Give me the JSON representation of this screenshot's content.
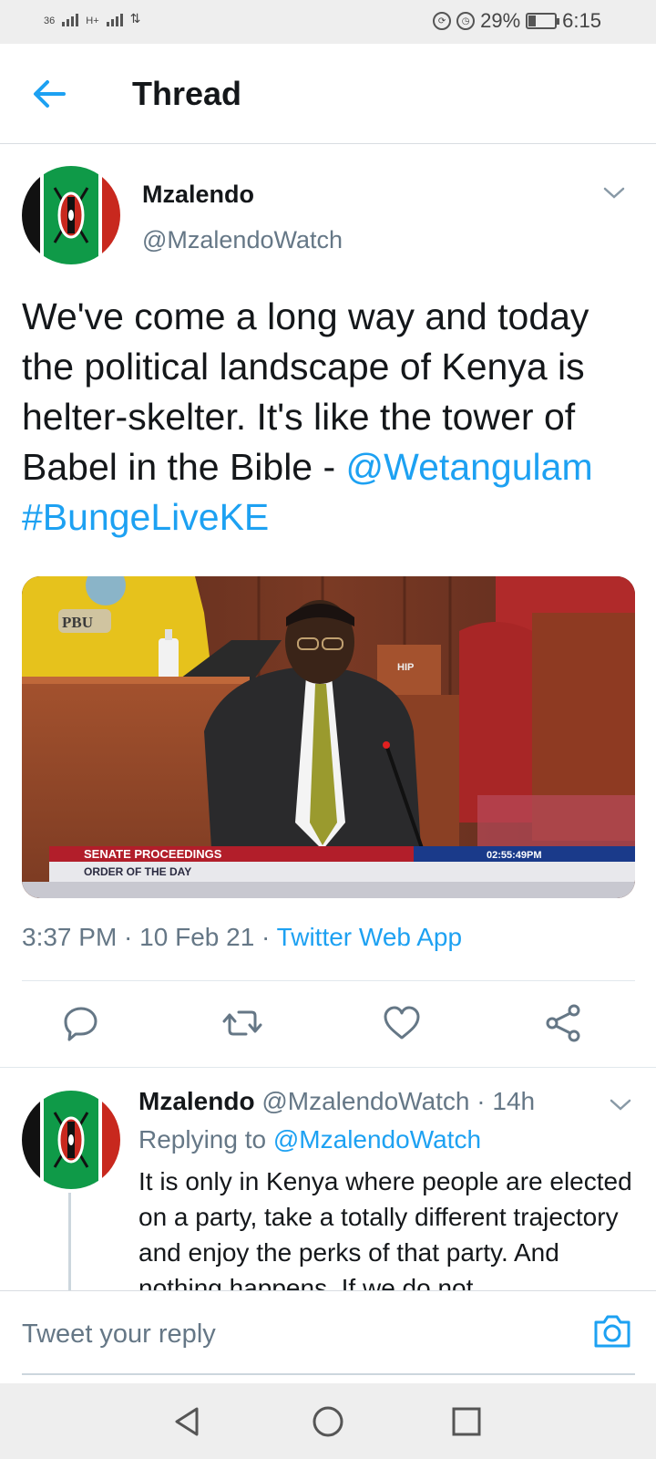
{
  "status_bar": {
    "network_1": "36",
    "network_2": "H+",
    "battery_percent": "29%",
    "battery_level": 0.29,
    "time": "6:15"
  },
  "header": {
    "title": "Thread"
  },
  "main_tweet": {
    "author_name": "Mzalendo",
    "author_handle": "@MzalendoWatch",
    "text_body": "We've come a long way and today the political landscape of Kenya is helter-skelter. It's like the tower of Babel in the Bible - ",
    "mention": "@Wetangulam",
    "hashtag": "#BungeLiveKE",
    "media": {
      "logo_text": "PBU",
      "ticker_title": "SENATE PROCEEDINGS",
      "ticker_time": "02:55:49PM",
      "ticker_subtitle": "ORDER OF THE DAY",
      "placard_text": "HIP"
    },
    "time": "3:37 PM",
    "date": "10 Feb 21",
    "separator": " · ",
    "source": "Twitter Web App"
  },
  "reply_tweet": {
    "author_name": "Mzalendo",
    "author_handle": "@MzalendoWatch",
    "age": "14h",
    "separator": " · ",
    "replying_to_label": "Replying to",
    "replying_to_handle": "@MzalendoWatch",
    "text": "It is only in Kenya where people are elected on a party, take a totally different trajectory and enjoy the perks of that party. And nothing happens. If we do not"
  },
  "compose": {
    "placeholder": "Tweet your reply"
  },
  "icons": {
    "back": "arrow-left-icon",
    "reply": "speech-bubble-icon",
    "retweet": "retweet-icon",
    "like": "heart-icon",
    "share": "share-icon",
    "camera": "camera-icon",
    "nav_back": "triangle-back-icon",
    "nav_home": "circle-home-icon",
    "nav_recents": "square-recents-icon"
  },
  "colors": {
    "accent": "#1da1f2",
    "text_primary": "#14171a",
    "text_secondary": "#657786"
  }
}
